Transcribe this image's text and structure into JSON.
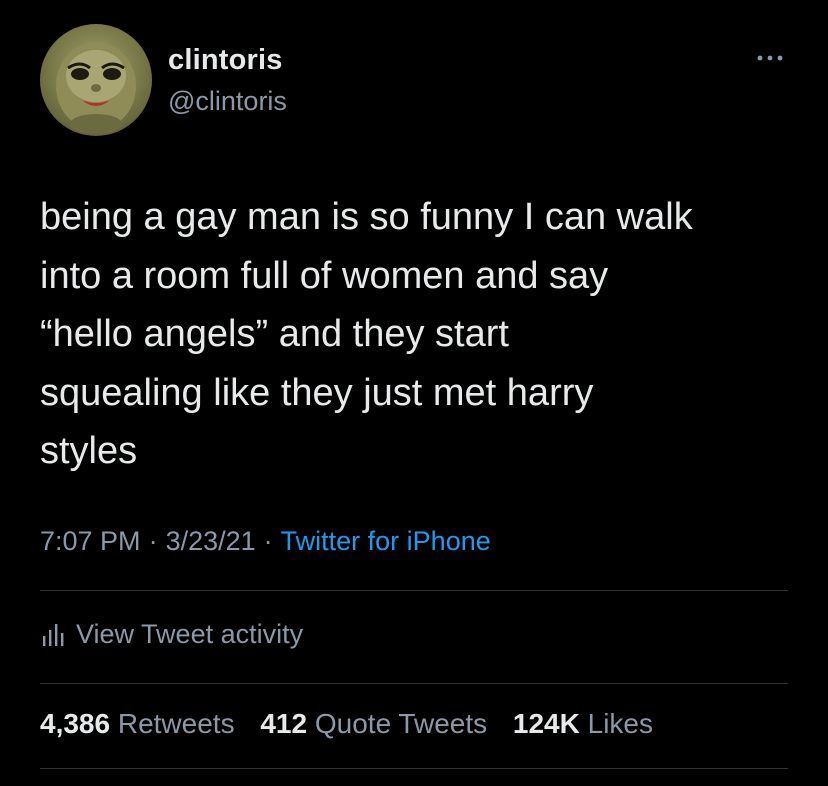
{
  "author": {
    "display_name": "clintoris",
    "handle": "@clintoris",
    "avatar_icon": "profile-avatar"
  },
  "more_icon": "more-options-icon",
  "tweet": {
    "text": "being a gay man is so funny I can walk\ninto a room full of women and say\n“hello angels” and they start\nsquealing like they just met harry\nstyles"
  },
  "meta": {
    "time": "7:07 PM",
    "date": "3/23/21",
    "source": "Twitter for iPhone",
    "separator": "·"
  },
  "activity": {
    "icon": "bar-chart-icon",
    "label": "View Tweet activity"
  },
  "stats": {
    "retweets": {
      "count": "4,386",
      "label": "Retweets"
    },
    "quotes": {
      "count": "412",
      "label": "Quote Tweets"
    },
    "likes": {
      "count": "124K",
      "label": "Likes"
    }
  },
  "colors": {
    "background": "#000000",
    "primary_text": "#e7e9ea",
    "secondary_text": "#8b98a5",
    "link": "#1d9bf0",
    "divider": "#2f3336"
  }
}
